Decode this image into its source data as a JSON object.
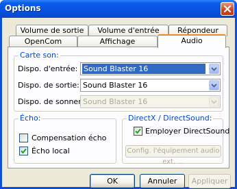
{
  "window": {
    "title": "Options"
  },
  "tabs": {
    "row1": [
      {
        "label": "Volume de sortie"
      },
      {
        "label": "Volume d'entrée"
      },
      {
        "label": "Répondeur"
      }
    ],
    "row2": [
      {
        "label": "OpenCom"
      },
      {
        "label": "Affichage"
      },
      {
        "label": "Audio",
        "active": true
      }
    ]
  },
  "sound_card": {
    "legend": "Carte son:",
    "input_label": "Dispo. d'entrée:",
    "input_value": "Sound Blaster 16",
    "output_label": "Dispo. de sortie:",
    "output_value": "Sound Blaster 16",
    "ring_label": "Dispo. de sonner:",
    "ring_value": "Sound Blaster 16"
  },
  "echo": {
    "legend": "Écho:",
    "compensation_label": "Compensation écho",
    "compensation_checked": false,
    "local_label": "Écho local",
    "local_checked": true
  },
  "directx": {
    "legend": "DirectX / DirectSound:",
    "use_label": "Employer DirectSound",
    "use_checked": true,
    "config_label": "Config. l'équipement audio ext. ..."
  },
  "buttons": {
    "ok": "OK",
    "cancel": "Annuler",
    "apply": "Appliquer"
  },
  "colors": {
    "titlebar": "#0a50dc",
    "legend": "#0046d5",
    "selection": "#316ac5",
    "tab_active_accent": "#e68b2c"
  }
}
